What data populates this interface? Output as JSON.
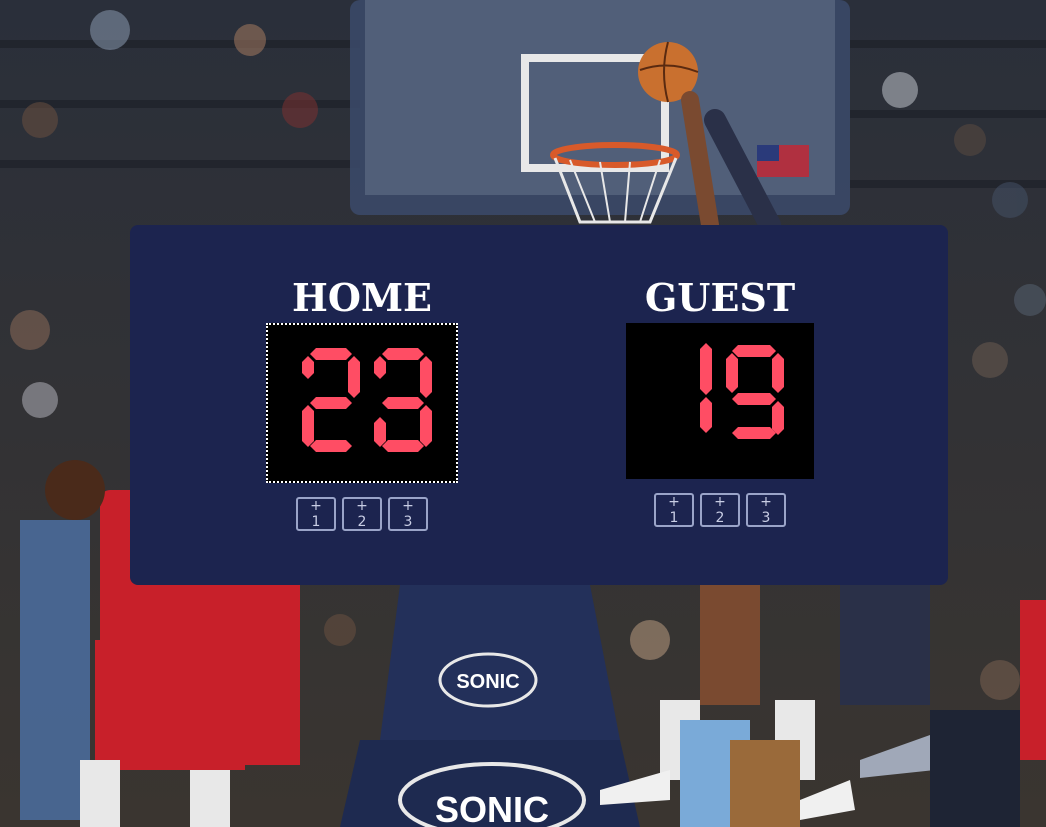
{
  "colors": {
    "panel": "#1c244f",
    "digit": "#ff4d64",
    "score_bg": "#000000",
    "button_border": "#9aa4c8"
  },
  "home": {
    "label": "HOME",
    "score": "23",
    "buttons": [
      "+ 1",
      "+ 2",
      "+ 3"
    ]
  },
  "guest": {
    "label": "GUEST",
    "score": "19",
    "buttons": [
      "+ 1",
      "+ 2",
      "+ 3"
    ]
  },
  "background": {
    "description_icon": "basketball-arena-photo",
    "sponsor_text": "SONIC"
  }
}
